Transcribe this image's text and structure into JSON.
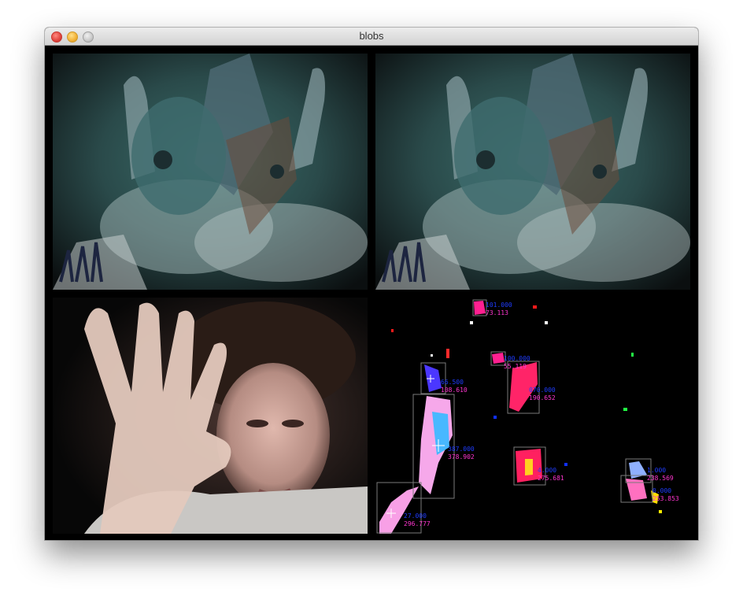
{
  "window": {
    "title": "blobs"
  },
  "colors": {
    "label_x": "#1f3cff",
    "label_y": "#ff36d0",
    "bbox": "#7a7a7a"
  },
  "blobs": [
    {
      "x": "101.000",
      "y": "73.113"
    },
    {
      "x": "100.000",
      "y": "55.119"
    },
    {
      "x": "66.500",
      "y": "108.610"
    },
    {
      "x": "070.000",
      "y": "190.652"
    },
    {
      "x": "387.000",
      "y": "378.902"
    },
    {
      "x": "4.000",
      "y": "275.681"
    },
    {
      "x": "27.000",
      "y": "296.777"
    },
    {
      "x": "1.000",
      "y": "238.569"
    },
    {
      "x": "0.000",
      "y": "253.853"
    }
  ]
}
